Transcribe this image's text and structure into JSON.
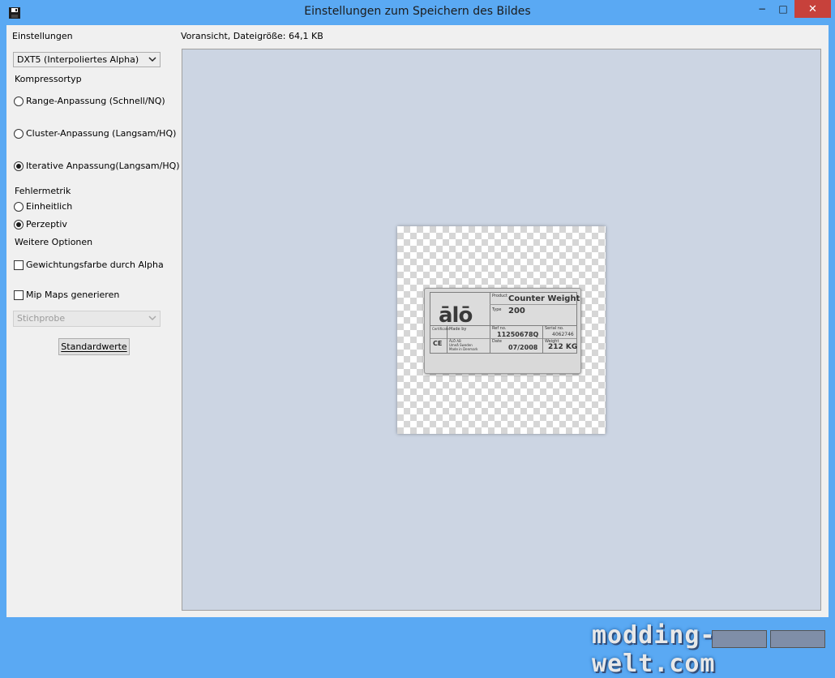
{
  "window": {
    "title": "Einstellungen zum Speichern des Bildes",
    "minimize": "−",
    "maximize": "□",
    "close": "✕"
  },
  "settings": {
    "header": "Einstellungen",
    "format_value": "DXT5 (Interpoliertes Alpha)",
    "compressor_label": "Kompressortyp",
    "compressor_options": [
      {
        "label": "Range-Anpassung (Schnell/NQ)",
        "checked": false
      },
      {
        "label": "Cluster-Anpassung (Langsam/HQ)",
        "checked": false
      },
      {
        "label": "Iterative Anpassung(Langsam/HQ)",
        "checked": true
      }
    ],
    "error_metric_label": "Fehlermetrik",
    "error_metric_options": [
      {
        "label": "Einheitlich",
        "checked": false
      },
      {
        "label": "Perzeptiv",
        "checked": true
      }
    ],
    "more_options_label": "Weitere Optionen",
    "weight_alpha_label": "Gewichtungsfarbe durch Alpha",
    "weight_alpha_checked": false,
    "mipmaps_label": "Mip Maps generieren",
    "mipmaps_checked": false,
    "sampling_value": "Stichprobe",
    "defaults_button": "Standardwerte"
  },
  "preview": {
    "label": "Voransicht, Dateigröße: 64,1 KB",
    "plate": {
      "logo": "ālō",
      "product_label": "Product",
      "product": "Counter Weight",
      "type_label": "Type",
      "type": "200",
      "made_by": "Made by",
      "maker": "ÅLÖ AB",
      "maker_city": "Umeå Sweden",
      "maker_country": "Made in Denmark",
      "ref_label": "Ref no.",
      "ref": "11250678Q",
      "serial_label": "Serial no.",
      "serial": "4062746",
      "date_label": "Date",
      "date": "07/2008",
      "weight_label": "Weight",
      "weight": "212 KG",
      "ce": "CE",
      "certificate": "Certificate"
    }
  },
  "footer": {
    "watermark": "modding-welt.com"
  }
}
